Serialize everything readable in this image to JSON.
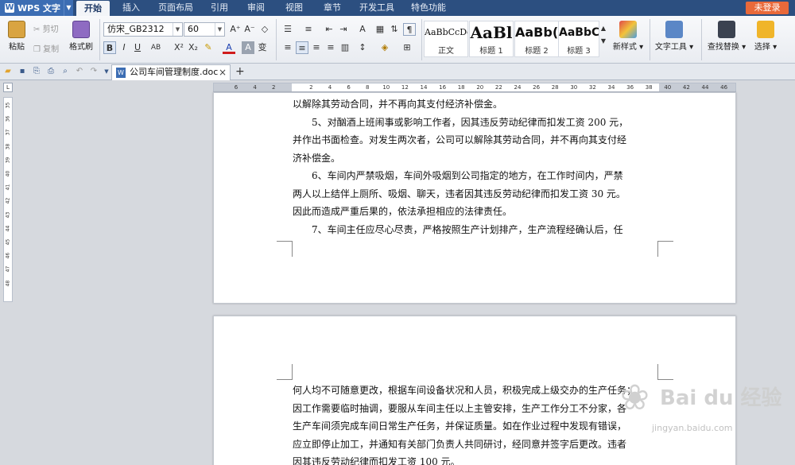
{
  "app": {
    "logo_label": "WPS 文字",
    "login_label": "未登录"
  },
  "menu_tabs": [
    "开始",
    "插入",
    "页面布局",
    "引用",
    "审阅",
    "视图",
    "章节",
    "开发工具",
    "特色功能"
  ],
  "ribbon": {
    "paste": "粘贴",
    "cut": "剪切",
    "copy": "复制",
    "format_painter": "格式刷",
    "font_name": "仿宋_GB2312",
    "font_size": "60",
    "styles": [
      {
        "sample": "AaBbCcDd",
        "name": "正文"
      },
      {
        "sample": "AaBl",
        "name": "标题 1"
      },
      {
        "sample": "AaBb(",
        "name": "标题 2"
      },
      {
        "sample": "AaBbC",
        "name": "标题 3"
      }
    ],
    "new_style": "新样式",
    "text_tools": "文字工具",
    "find_replace": "查找替换",
    "select": "选择"
  },
  "document_tab": {
    "title": "公司车间管理制度.doc"
  },
  "h_ruler_ticks": [
    "6",
    "4",
    "2",
    "",
    "2",
    "4",
    "6",
    "8",
    "10",
    "12",
    "14",
    "16",
    "18",
    "20",
    "22",
    "24",
    "26",
    "28",
    "30",
    "32",
    "34",
    "36",
    "38",
    "40",
    "42",
    "44",
    "46"
  ],
  "v_ruler_ticks": [
    "35",
    "36",
    "37",
    "38",
    "39",
    "40",
    "41",
    "42",
    "43",
    "44",
    "45",
    "46",
    "47",
    "48"
  ],
  "page1_lines": [
    "以解除其劳动合同，并不再向其支付经济补偿金。",
    "　　5、对酗酒上班闹事或影响工作者，因其违反劳动纪律而扣发工资 200 元，",
    "并作出书面检查。对发生两次者，公司可以解除其劳动合同，并不再向其支付经",
    "济补偿金。",
    "　　6、车间内严禁吸烟，车间外吸烟到公司指定的地方，在工作时间内，严禁",
    "两人以上结伴上厕所、吸烟、聊天，违者因其违反劳动纪律而扣发工资 30 元。",
    "因此而造成严重后果的，依法承担相应的法律责任。",
    "　　7、车间主任应尽心尽责，严格按照生产计划排产，生产流程经确认后，任"
  ],
  "page2_lines": [
    "何人均不可随意更改，根据车间设备状况和人员，积极完成上级交办的生产任务；",
    "因工作需要临时抽调，要服从车间主任以上主管安排，生产工作分工不分家，各",
    "生产车间须完成车间日常生产任务，并保证质量。如在作业过程中发现有错误，",
    "应立即停止加工，并通知有关部门负责人共同研讨，经同意并签字后更改。违者",
    "因其违反劳动纪律而扣发工资 100 元。"
  ],
  "watermark": {
    "brand": "Bai du 经验",
    "url": "jingyan.baidu.com"
  }
}
